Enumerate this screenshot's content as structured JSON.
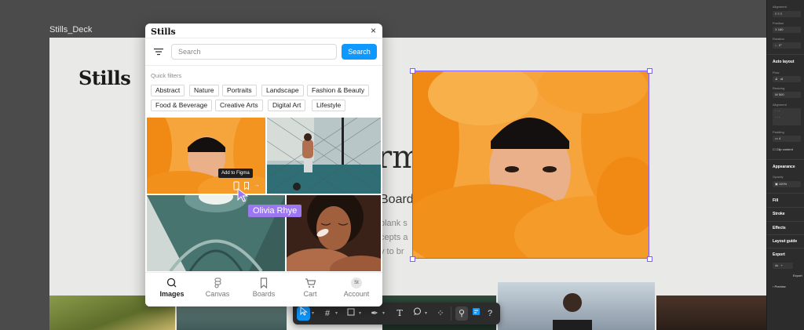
{
  "canvas": {
    "frame_title": "Stills_Deck",
    "deck": {
      "logo": "Stills",
      "big_word_fragment": "rm",
      "sub_fragment": "Board",
      "body_lines": [
        "blank s",
        "cepts a",
        "y to br"
      ]
    },
    "cursor_user": "Olivia Rhye",
    "selection_color": "#7b61ff"
  },
  "plugin": {
    "title": "Stills",
    "close_glyph": "×",
    "search": {
      "placeholder": "Search",
      "value": "",
      "button_label": "Search"
    },
    "quick_filters_label": "Quick filters",
    "quick_filters": [
      "Abstract",
      "Nature",
      "Portraits",
      "Landscape",
      "Fashion & Beauty",
      "Food & Beverage",
      "Creative Arts",
      "Digital Art",
      "Lifestyle"
    ],
    "tooltip": "Add to Figma",
    "images": [
      {
        "desc": "woman-with-orange-balloons"
      },
      {
        "desc": "basketball-player-court"
      },
      {
        "desc": "spiral-staircase-green"
      },
      {
        "desc": "woman-skincare"
      }
    ],
    "nav": [
      {
        "label": "Images",
        "icon": "search-icon",
        "active": true
      },
      {
        "label": "Canvas",
        "icon": "figma-icon",
        "active": false
      },
      {
        "label": "Boards",
        "icon": "bookmark-icon",
        "active": false
      },
      {
        "label": "Cart",
        "icon": "cart-icon",
        "active": false
      },
      {
        "label": "Account",
        "icon": "avatar",
        "active": false,
        "avatar_text": "St"
      }
    ]
  },
  "right_panel": {
    "alignment": "Alignment",
    "position": "Position",
    "x_label": "X",
    "x_value": "160",
    "rotation": "Rotation",
    "rotation_value": "0°",
    "auto_layout": "Auto layout",
    "flow": "Flow",
    "resizing": "Resizing",
    "w_label": "W",
    "w_value": "500",
    "alignment2": "Alignment",
    "padding": "Padding",
    "padding_value": "4",
    "clip_content": "Clip content",
    "appearance": "Appearance",
    "opacity": "Opacity",
    "opacity_value": "100%",
    "fill": "Fill",
    "stroke": "Stroke",
    "effects": "Effects",
    "layout_guide": "Layout guide",
    "export": "Export",
    "export_scale": "4x",
    "export_button": "Export",
    "preview": "Preview"
  },
  "toolbar": {
    "tools": [
      "move-tool",
      "frame-tool",
      "shape-tool",
      "pen-tool",
      "text-tool",
      "comment-tool",
      "actions-tool",
      "dev-mode-toggle",
      "plugins-tool",
      "help-tool"
    ],
    "help_glyph": "?",
    "text_glyph": "T",
    "accent": "#0d99ff"
  }
}
